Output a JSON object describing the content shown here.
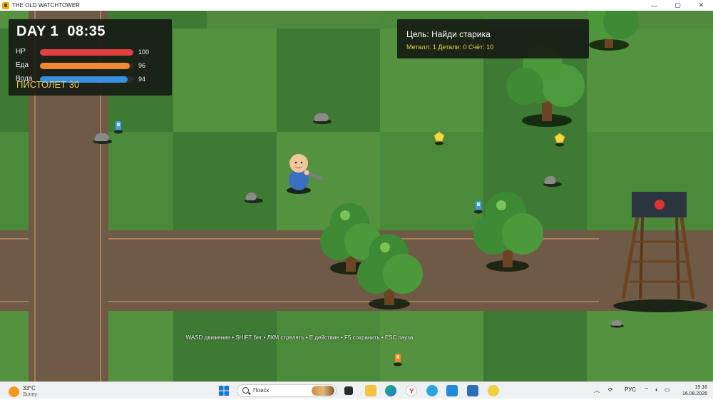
{
  "window": {
    "title": "THE OLD WATCHTOWER",
    "controls": {
      "minimize": "—",
      "maximize": "▢",
      "close": "✕"
    }
  },
  "hud": {
    "day": "DAY 1",
    "time": "08:35",
    "stats": [
      {
        "label": "HP",
        "value": 100,
        "max": 100,
        "color": "#e04040"
      },
      {
        "label": "Еда",
        "value": 96,
        "max": 100,
        "color": "#f08a30"
      },
      {
        "label": "Вода",
        "value": 94,
        "max": 100,
        "color": "#3a90e0"
      }
    ],
    "weapon": "ПИСТОЛЕТ 30"
  },
  "quest": {
    "goal": "Цель: Найди старика",
    "resources": "Металл: 1  Детали: 0  Счёт: 10"
  },
  "hint": "WASD движение • SHIFT бег • ЛКМ стрелять • E действие • F5 сохранить • ESC пауза",
  "colors": {
    "grass_light": "#55923f",
    "grass_mid": "#4a8a3a",
    "grass_dark": "#3e7a33",
    "road": "#6e5a45",
    "hud_bg": "#161c14",
    "weapon_text": "#f2d060",
    "resource_text": "#f2c948"
  },
  "entities": {
    "player": {
      "name": "player-character",
      "weapon": "pistol"
    },
    "watchtower_light": "red-lamp",
    "pickups": [
      {
        "type": "gem-yellow"
      },
      {
        "type": "gem-yellow"
      },
      {
        "type": "bottle-blue"
      },
      {
        "type": "bottle-blue"
      },
      {
        "type": "canister-orange"
      }
    ]
  },
  "taskbar": {
    "weather": {
      "temp": "33°C",
      "condition": "Sunny"
    },
    "search_placeholder": "Поиск",
    "language": "РУС",
    "time": "15:16",
    "date": "16.08.2026",
    "apps": [
      "start-icon",
      "search-icon",
      "task-view-icon",
      "file-explorer-icon",
      "edge-icon",
      "yandex-browser-icon",
      "telegram-icon",
      "vscode-icon",
      "store-icon",
      "python-icon"
    ]
  }
}
